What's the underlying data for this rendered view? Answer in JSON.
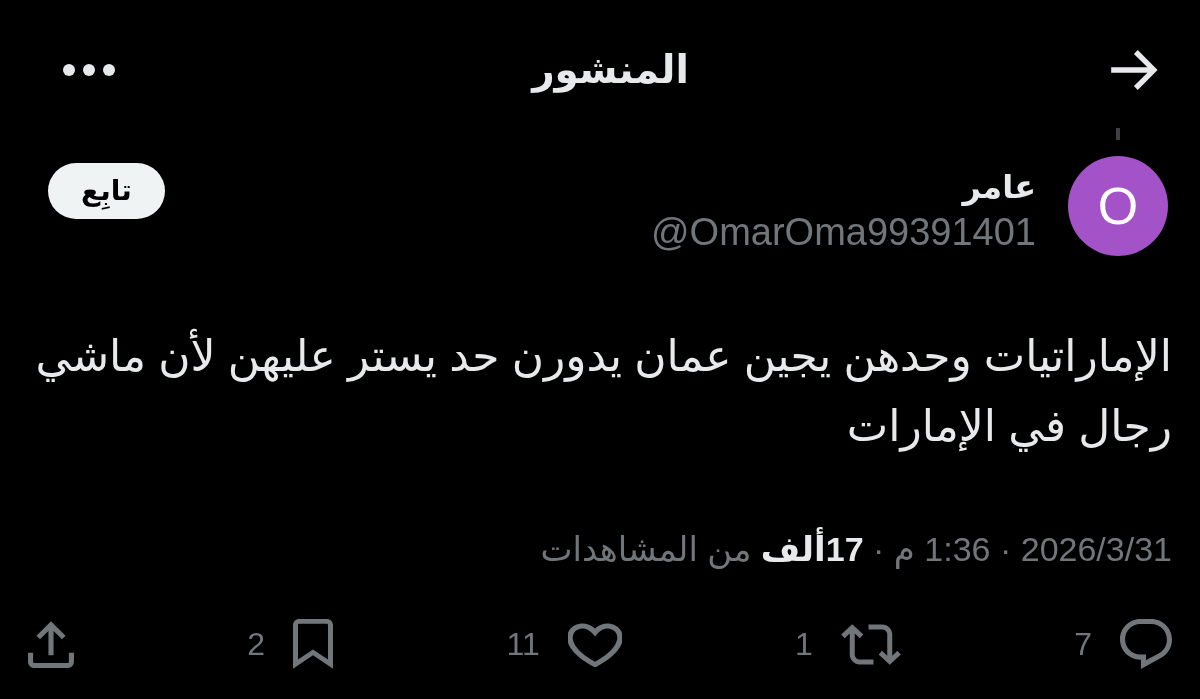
{
  "header": {
    "title": "المنشور"
  },
  "post": {
    "avatar_letter": "O",
    "name": "عامر",
    "handle": "@OmarOma99391401",
    "follow_label": "تابِع",
    "text": "الإماراتيات وحدهن يجين عمان يدورن حد يستر عليهن لأن ماشي رجال في الإمارات",
    "meta": "2026/3/31 · 1:36 م · **17ألف** من المشاهدات"
  },
  "actions": [
    {
      "kind": "reply",
      "count": "7"
    },
    {
      "kind": "repost",
      "count": "1"
    },
    {
      "kind": "like",
      "count": "11"
    },
    {
      "kind": "bookmark",
      "count": "2"
    },
    {
      "kind": "share"
    }
  ]
}
